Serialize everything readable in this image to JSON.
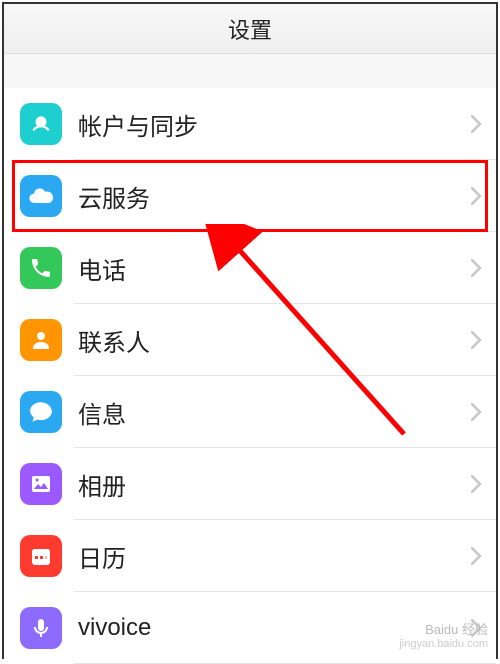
{
  "header": {
    "title": "设置"
  },
  "rows": [
    {
      "id": "account-sync",
      "label": "帐户与同步",
      "icon": "account-sync-icon",
      "bg": "bg-teal"
    },
    {
      "id": "cloud-service",
      "label": "云服务",
      "icon": "cloud-icon",
      "bg": "bg-blue"
    },
    {
      "id": "phone",
      "label": "电话",
      "icon": "phone-icon",
      "bg": "bg-green"
    },
    {
      "id": "contacts",
      "label": "联系人",
      "icon": "contacts-icon",
      "bg": "bg-orange"
    },
    {
      "id": "messages",
      "label": "信息",
      "icon": "message-icon",
      "bg": "bg-blue2"
    },
    {
      "id": "gallery",
      "label": "相册",
      "icon": "gallery-icon",
      "bg": "bg-purple"
    },
    {
      "id": "calendar",
      "label": "日历",
      "icon": "calendar-icon",
      "bg": "bg-red"
    },
    {
      "id": "vivoice",
      "label": "vivoice",
      "icon": "mic-icon",
      "bg": "bg-violet"
    }
  ],
  "highlight": {
    "rowIndex": 1
  },
  "watermark": {
    "brand": "Baidu 经验",
    "url": "jingyan.baidu.com"
  }
}
